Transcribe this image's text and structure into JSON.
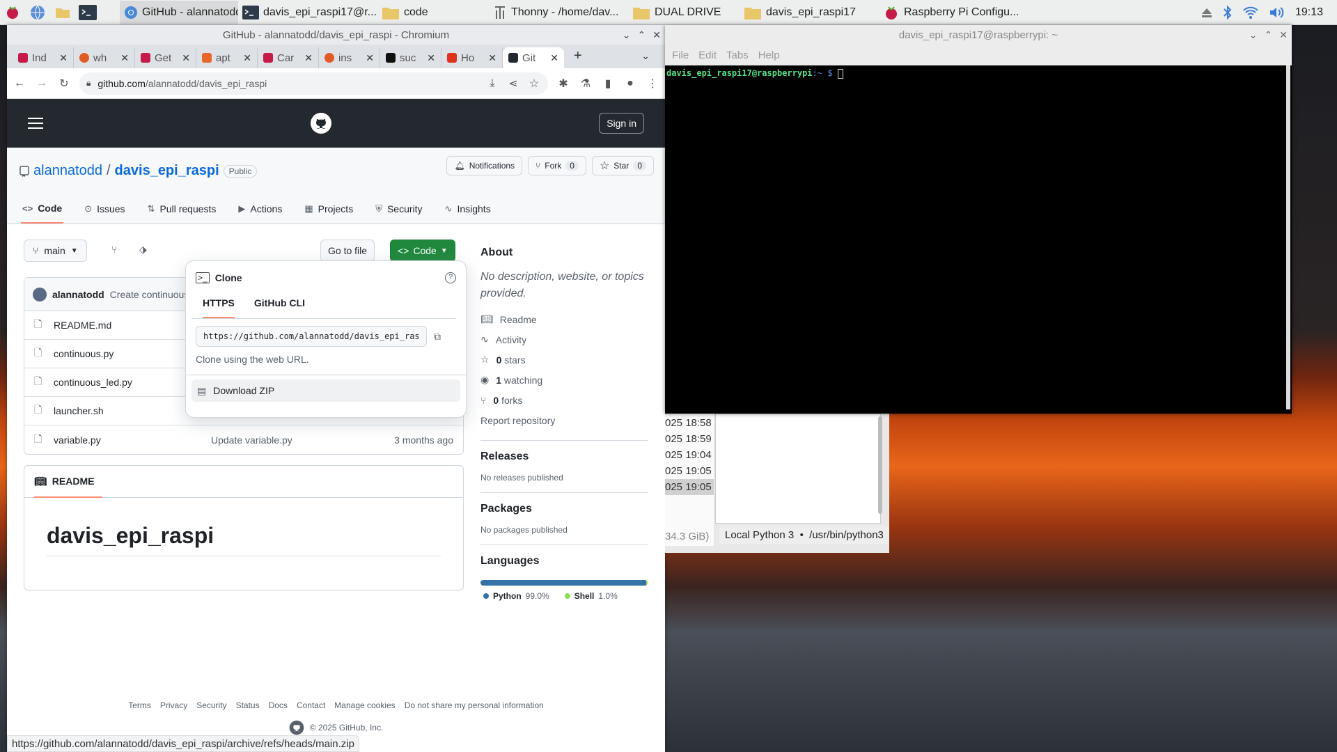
{
  "taskbar": {
    "tasks": [
      {
        "label": "GitHub - alannatodd/...",
        "icon": "chromium-icon",
        "active": true
      },
      {
        "label": "davis_epi_raspi17@r...",
        "icon": "terminal-icon"
      },
      {
        "label": "code",
        "icon": "folder-icon"
      },
      {
        "label": "Thonny  -  /home/dav...",
        "icon": "thonny-icon"
      },
      {
        "label": "DUAL DRIVE",
        "icon": "folder-icon"
      },
      {
        "label": "davis_epi_raspi17",
        "icon": "folder-icon"
      },
      {
        "label": "Raspberry Pi Configu...",
        "icon": "raspberry-icon"
      }
    ],
    "clock": "19:13"
  },
  "browser": {
    "title": "GitHub - alannatodd/davis_epi_raspi - Chromium",
    "tabs": [
      "Ind",
      "wh",
      "Get",
      "apt",
      "Car",
      "ins",
      "suc",
      "Ho",
      "Git"
    ],
    "url_host": "github.com",
    "url_path": "/alannatodd/davis_epi_raspi",
    "status_url": "https://github.com/alannatodd/davis_epi_raspi/archive/refs/heads/main.zip"
  },
  "github": {
    "sign_in": "Sign in",
    "owner": "alannatodd",
    "sep": "/",
    "repo": "davis_epi_raspi",
    "visibility": "Public",
    "notifications": "Notifications",
    "fork": "Fork",
    "fork_count": "0",
    "star": "Star",
    "star_count": "0",
    "nav": [
      "Code",
      "Issues",
      "Pull requests",
      "Actions",
      "Projects",
      "Security",
      "Insights"
    ],
    "branch": "main",
    "go_to_file": "Go to file",
    "code_btn": "Code",
    "commit_author": "alannatodd",
    "commit_msg": "Create continuous",
    "files": [
      {
        "name": "README.md",
        "msg": "",
        "date": ""
      },
      {
        "name": "continuous.py",
        "msg": "",
        "date": ""
      },
      {
        "name": "continuous_led.py",
        "msg": "",
        "date": ""
      },
      {
        "name": "launcher.sh",
        "msg": "",
        "date": ""
      },
      {
        "name": "variable.py",
        "msg": "Update variable.py",
        "date": "3 months ago"
      }
    ],
    "readme_tab": "README",
    "readme_title": "davis_epi_raspi",
    "about": {
      "heading": "About",
      "desc": "No description, website, or topics provided.",
      "readme": "Readme",
      "activity": "Activity",
      "stars_n": "0",
      "stars": "stars",
      "watching_n": "1",
      "watching": "watching",
      "forks_n": "0",
      "forks": "forks",
      "report": "Report repository"
    },
    "releases": {
      "heading": "Releases",
      "text": "No releases published"
    },
    "packages": {
      "heading": "Packages",
      "text": "No packages published"
    },
    "languages": {
      "heading": "Languages",
      "items": [
        {
          "name": "Python",
          "pct": "99.0%",
          "value": 99.0,
          "color": "#3572a5"
        },
        {
          "name": "Shell",
          "pct": "1.0%",
          "value": 1.0,
          "color": "#89e051"
        }
      ]
    },
    "clone": {
      "title": "Clone",
      "tab_https": "HTTPS",
      "tab_cli": "GitHub CLI",
      "url": "https://github.com/alannatodd/davis_epi_raspi.git",
      "hint": "Clone using the web URL.",
      "download": "Download ZIP"
    },
    "footer_links": [
      "Terms",
      "Privacy",
      "Security",
      "Status",
      "Docs",
      "Contact",
      "Manage cookies",
      "Do not share my personal information"
    ],
    "copyright": "© 2025 GitHub, Inc."
  },
  "terminal": {
    "title": "davis_epi_raspi17@raspberrypi: ~",
    "menu": [
      "File",
      "Edit",
      "Tabs",
      "Help"
    ],
    "prompt_user": "davis_epi_raspi17@raspberrypi",
    "prompt_path": ":~ $"
  },
  "thonny": {
    "times": [
      "025 18:58",
      "025 18:59",
      "025 19:04",
      "025 19:05",
      "025 19:05"
    ],
    "size": "34.3 GiB)",
    "interpreter": "Local Python 3  •  /usr/bin/python3"
  }
}
